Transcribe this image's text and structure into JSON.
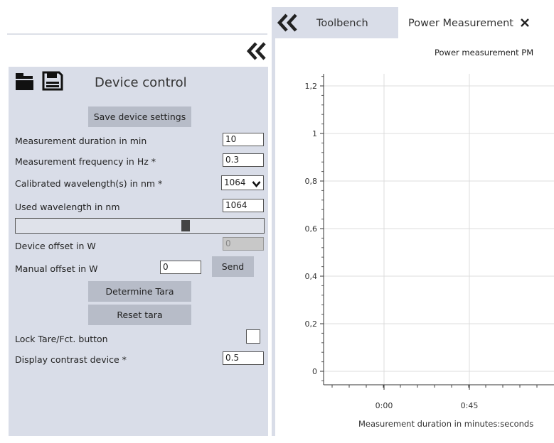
{
  "left_panel": {
    "title": "Device control",
    "save_button": "Save device settings",
    "rows": {
      "measurement_duration": {
        "label": "Measurement duration in min",
        "value": "10"
      },
      "measurement_frequency": {
        "label": "Measurement frequency in Hz *",
        "value": "0.3"
      },
      "calibrated_wavelength": {
        "label": "Calibrated wavelength(s) in nm *",
        "value": "1064"
      },
      "used_wavelength": {
        "label": "Used wavelength in nm",
        "value": "1064"
      },
      "device_offset": {
        "label": "Device offset in W",
        "value": "0"
      },
      "manual_offset": {
        "label": "Manual offset in W",
        "value": "0"
      },
      "lock_tare": {
        "label": "Lock Tare/Fct. button"
      },
      "display_contrast": {
        "label": "Display contrast device *",
        "value": "0.5"
      }
    },
    "send_button": "Send",
    "determine_tara_button": "Determine Tara",
    "reset_tara_button": "Reset tara",
    "slider_fraction": 0.69,
    "lock_checked": false
  },
  "tabs": {
    "toolbench": "Toolbench",
    "power_measurement": "Power Measurement"
  },
  "chart_data": {
    "type": "line",
    "title": "Power measurement PM",
    "xlabel": "Measurement duration in minutes:seconds",
    "ylabel": "",
    "y_ticks": [
      "0",
      "0,2",
      "0,4",
      "0,6",
      "0,8",
      "1",
      "1,2"
    ],
    "x_ticks": [
      "0:00",
      "0:45"
    ],
    "series": [],
    "grid": true
  },
  "colors": {
    "panel_bg": "#d9dde8",
    "button_bg": "#b7bcc8"
  }
}
